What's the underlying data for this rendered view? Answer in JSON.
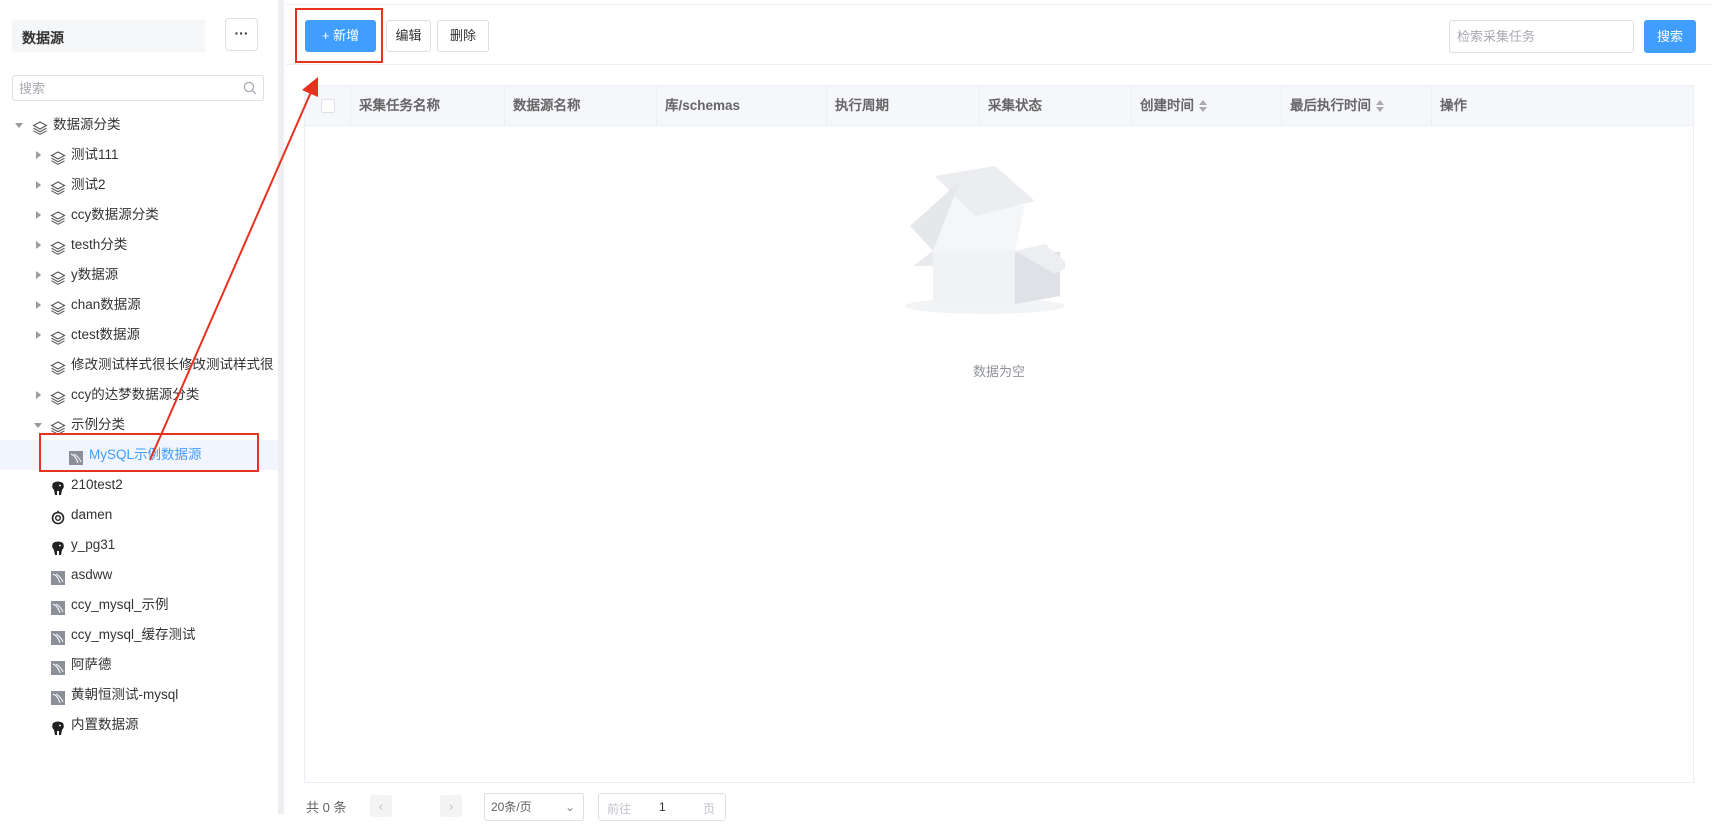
{
  "sidebar": {
    "title": "数据源",
    "more_label": "···",
    "search_placeholder": "搜索",
    "root": "数据源分类",
    "items": [
      {
        "label": "测试111"
      },
      {
        "label": "测试2"
      },
      {
        "label": "ccy数据源分类"
      },
      {
        "label": "testh分类"
      },
      {
        "label": "y数据源"
      },
      {
        "label": "chan数据源"
      },
      {
        "label": "ctest数据源"
      },
      {
        "label": "修改测试样式很长修改测试样式很"
      },
      {
        "label": "ccy的达梦数据源分类"
      },
      {
        "label": "示例分类"
      },
      {
        "label": "MySQL示例数据源"
      },
      {
        "label": "210test2"
      },
      {
        "label": "damen"
      },
      {
        "label": "y_pg31"
      },
      {
        "label": "asdww"
      },
      {
        "label": "ccy_mysql_示例"
      },
      {
        "label": "ccy_mysql_缓存测试"
      },
      {
        "label": "阿萨德"
      },
      {
        "label": "黄朝恒测试-mysql"
      },
      {
        "label": "内置数据源"
      }
    ]
  },
  "toolbar": {
    "add_label": "+ 新增",
    "edit_label": "编辑",
    "delete_label": "删除",
    "search_placeholder": "检索采集任务",
    "search_button": "搜索"
  },
  "table": {
    "columns": [
      "采集任务名称",
      "数据源名称",
      "库/schemas",
      "执行周期",
      "采集状态",
      "创建时间",
      "最后执行时间",
      "操作"
    ],
    "empty_text": "数据为空"
  },
  "pagination": {
    "total": "共 0 条",
    "prev": "‹",
    "next": "›",
    "page_size": "20条/页",
    "goto_prefix": "前往",
    "goto_value": "1",
    "goto_suffix": "页"
  },
  "colors": {
    "primary": "#409eff",
    "annotation": "#e8321e"
  },
  "icons": {
    "search": "search-icon",
    "layers": "layers-icon",
    "mysql": "mysql-icon",
    "postgres": "postgresql-elephant-icon",
    "dameng": "dameng-icon"
  }
}
